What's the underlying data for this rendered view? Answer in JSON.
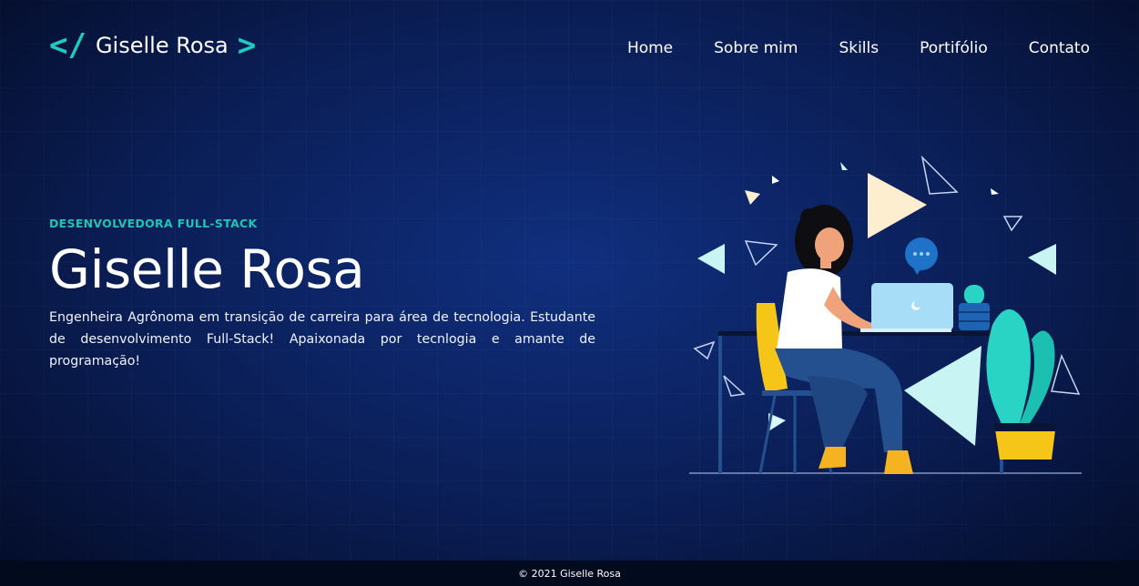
{
  "header": {
    "logo_open": "</",
    "logo_text": "Giselle Rosa",
    "logo_close": ">",
    "nav": [
      "Home",
      "Sobre mim",
      "Skills",
      "Portifólio",
      "Contato"
    ]
  },
  "hero": {
    "subtitle": "DESENVOLVEDORA FULL-STACK",
    "name": "Giselle Rosa",
    "description": "Engenheira Agrônoma em transição de carreira para área de tecnologia. Estudante de desenvolvimento Full-Stack! Apaixonada por tecnlogia e amante de programação!"
  },
  "footer": {
    "copyright": "© 2021 Giselle Rosa"
  },
  "colors": {
    "accent": "#1ecbbf",
    "background": "#0b1f56",
    "illustration_yellow": "#f5c518",
    "illustration_teal": "#2ad4c4",
    "illustration_denim": "#24508f"
  },
  "icons": {
    "laptop": "laptop-icon",
    "chat": "chat-bubble-icon"
  }
}
